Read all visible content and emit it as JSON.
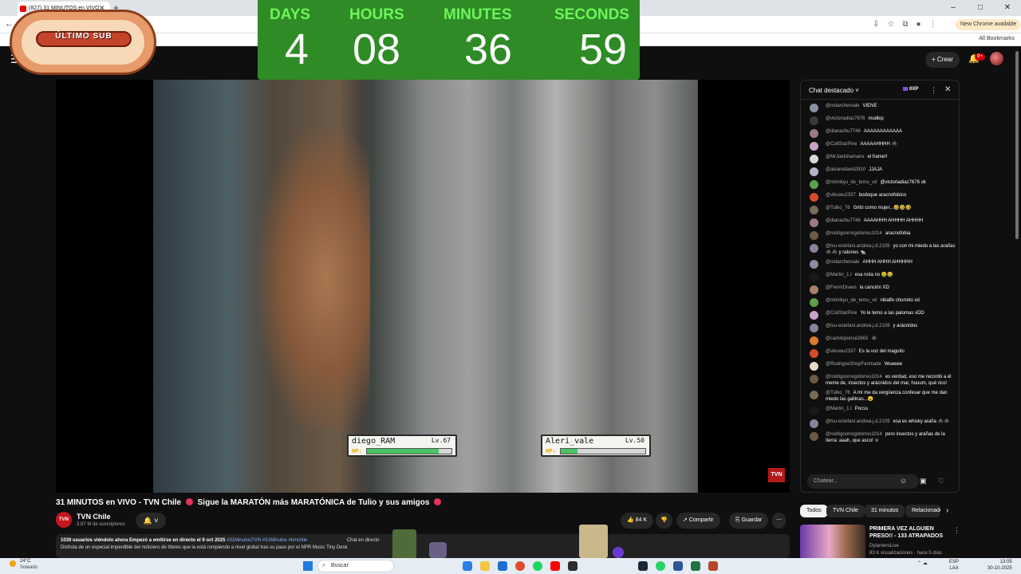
{
  "browser": {
    "tab_title": "(827) 31 MINUTOS en VIVO",
    "tab_close": "✕",
    "new_tab": "+",
    "update_button": "New Chrome available",
    "bookmarks": "All Bookmarks"
  },
  "header": {
    "create": "Crear",
    "notif_count": "9+"
  },
  "sticker": {
    "text": "ÚLTIMO SUB"
  },
  "countdown": {
    "days_label": "DAYS",
    "days": "4",
    "hours_label": "HOURS",
    "hours": "08",
    "minutes_label": "MINUTES",
    "minutes": "36",
    "seconds_label": "SECONDS",
    "seconds": "59"
  },
  "overlay": {
    "player1": {
      "name": "diego_RAM",
      "level": "Lv.67",
      "hp_label": "HP:",
      "hp_fraction": 0.85
    },
    "player2": {
      "name": "Aleri_vale",
      "level": "Lv.50",
      "hp_label": "HP:",
      "hp_fraction": 0.2
    },
    "watermark": "TVN"
  },
  "video": {
    "title_part1": "31 MINUTOS en VIVO - TVN Chile",
    "title_part2": "Sigue la MARATÓN más MARATÓNICA de Tulio y sus amigos",
    "channel_initials": "TVN",
    "channel": "TVN Chile",
    "subscribers": "3,97 M de suscriptores",
    "likes": "84 K",
    "share": "Compartir",
    "save": "Guardar",
    "more": "⋯",
    "views_meta": "1039 usuarios viéndolo ahora  Empezó a emitirse en directo el 9 oct 2025",
    "hashtags": "#31MinutosTVN #31Minutos #tvnchile",
    "description_line": "Disfruta de un especial imperdible del noticiero de títeres que la está rompiendo a nivel global tras su paso por el NPR Music Tiny Desk",
    "chat_replay": "Chat en directo"
  },
  "chat": {
    "title": "Chat destacado",
    "xp": "0XP",
    "input_placeholder": "Chatear...",
    "messages": [
      {
        "author": "@notarchervale",
        "text": "VIENE",
        "color": "#8a8fa0"
      },
      {
        "author": "@victoriadiaz7676",
        "text": "mudkip",
        "color": "#3a3a3a"
      },
      {
        "author": "@dianachu7746",
        "text": "AAAAAAAAAAAA",
        "color": "#9a7a8a"
      },
      {
        "author": "@ColiStarPine",
        "text": "AAAAAHHHH 🕷️",
        "color": "#c9a3c6"
      },
      {
        "author": "@MrJoelshamanx",
        "text": "el frame!!",
        "color": "#d8d8d8"
      },
      {
        "author": "@alvarodavid2910",
        "text": "JJAJA",
        "color": "#b5b5c8"
      },
      {
        "author": "@mimikyu_de_temu_xd",
        "text": "@victoriadiaz7676 ok",
        "color": "#5f9f4b"
      },
      {
        "author": "@vikuwu2337",
        "text": "bodoque aracnofobico",
        "color": "#d64b2b"
      },
      {
        "author": "@Tulko_76",
        "text": "Gritó como mujer...🤣🤣🤣",
        "color": "#7a6a5a"
      },
      {
        "author": "@dianachu7746",
        "text": "AAAAHHH AHHHH AHHHH",
        "color": "#9a7a8a"
      },
      {
        "author": "@rodrigoorregotorres1014",
        "text": "aracnofobia",
        "color": "#6b5a4a"
      },
      {
        "author": "@tsu-estefani.andrea.j.d.2109",
        "text": "yo con mi miedo a las arañas 🕷️🕷️ y ratones 🐀",
        "color": "#8f7f9f"
      },
      {
        "author": "@notarchervale",
        "text": "AHHH AHHH AHHHHH",
        "color": "#8a8fa0"
      },
      {
        "author": "@Martin_1.I",
        "text": "esa nota no 🤮🤮",
        "color": "#1a1a1a"
      },
      {
        "author": "@FenrirDraws",
        "text": "la canción XD",
        "color": "#a87f6a"
      },
      {
        "author": "@mimikyu_de_temu_xd",
        "text": "nibalfo churreto xd",
        "color": "#5f9f4b"
      },
      {
        "author": "@ColiStarPine",
        "text": "Yo le temo a las palomas xDD",
        "color": "#c9a3c6"
      },
      {
        "author": "@tsu-estefani.andrea.j.d.2109",
        "text": "y arácnidos",
        "color": "#8f7f9f"
      },
      {
        "author": "@camiloponce2863",
        "text": "🕷️",
        "color": "#e07a2a"
      },
      {
        "author": "@vikuwu2337",
        "text": "Es la voz del maguito",
        "color": "#d64b2b"
      },
      {
        "author": "@RodrigoeShopFanmade",
        "text": "Wueeee",
        "color": "#e8d8c8"
      },
      {
        "author": "@rodrigoorregotorres1014",
        "text": "es verdad, eso me recordó a él meme de, insectos y arácnidos del mar, huuum, qué rico!",
        "color": "#6b5a4a"
      },
      {
        "author": "@Tulko_76",
        "text": "A mí me da vergüenza confesar que me dan miedo las gallinas...😮",
        "color": "#7a6a5a"
      },
      {
        "author": "@Martin_1.I",
        "text": "Pocss",
        "color": "#1a1a1a"
      },
      {
        "author": "@tsu-estefani.andrea.j.d.2109",
        "text": "esa es whisky araña 🕷️🕷️",
        "color": "#8f7f9f"
      },
      {
        "author": "@rodrigoorregotorres1014",
        "text": "pero insectos y arañas de la tierra: aaah, que asco! :v",
        "color": "#6b5a4a"
      }
    ]
  },
  "related": {
    "chips": [
      "Todos",
      "TVN Chile",
      "31 minutos",
      "Relacionados"
    ],
    "title": "PRIMERA VEZ ALGUIEN PRESO!! - 133 ATRAPADOS",
    "channel": "DylanteroLive",
    "meta": "83 K visualizaciones · hace 5 días"
  },
  "taskbar": {
    "temp": "24°C",
    "weather": "Soleado",
    "search": "Buscar",
    "lang1": "ESP",
    "lang2": "LAA",
    "time": "13:05",
    "date": "30-10-2025"
  },
  "colors": {
    "accent_red": "#cc0000",
    "countdown_bg": "#2e8b25",
    "countdown_label": "#6ef55a"
  },
  "icons": [
    "menu-icon",
    "mic-icon",
    "bell-icon",
    "like-icon",
    "dislike-icon",
    "share-icon",
    "save-icon",
    "search-icon",
    "close-icon",
    "emoji-icon",
    "heart-icon",
    "windows-start-icon"
  ]
}
